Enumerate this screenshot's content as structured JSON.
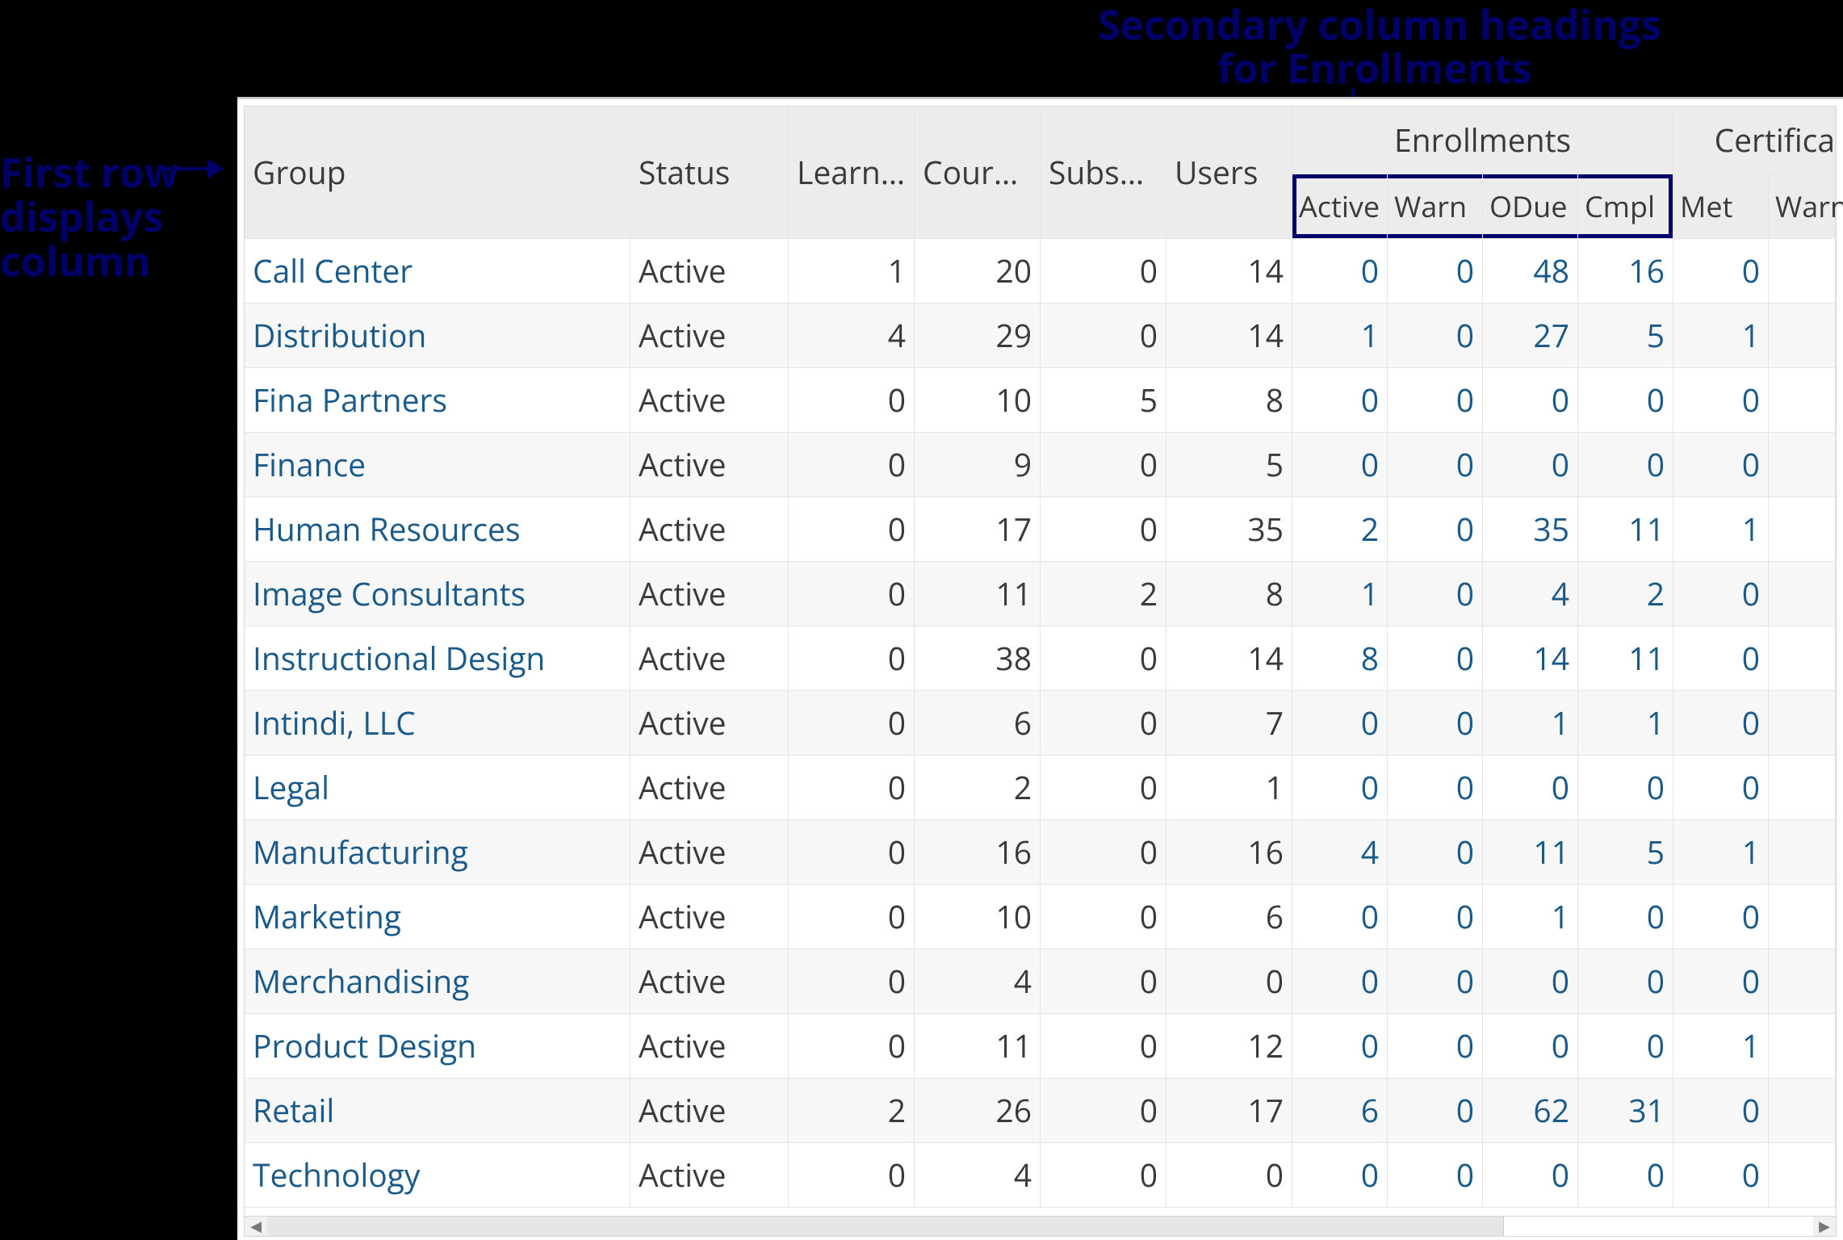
{
  "annotations": {
    "top_line1": "Secondary column headings",
    "top_line2": "for Enrollments",
    "left_line1": "First row",
    "left_line2": "displays",
    "left_line3": "column"
  },
  "headers": {
    "group": "Group",
    "status": "Status",
    "learning": "Learnin…",
    "courses": "Courses",
    "subscriptions": "Subscri…",
    "users": "Users",
    "enrollments_group": "Enrollments",
    "certifications_group": "Certifica",
    "enr_active": "Active",
    "enr_warn": "Warn",
    "enr_odue": "ODue",
    "enr_cmpl": "Cmpl",
    "cert_met": "Met",
    "cert_warn": "Warn"
  },
  "rows": [
    {
      "group": "Call Center",
      "status": "Active",
      "learning": "1",
      "courses": "20",
      "subs": "0",
      "users": "14",
      "e_active": "0",
      "e_warn": "0",
      "e_odue": "48",
      "e_cmpl": "16",
      "c_met": "0",
      "c_warn": ""
    },
    {
      "group": "Distribution",
      "status": "Active",
      "learning": "4",
      "courses": "29",
      "subs": "0",
      "users": "14",
      "e_active": "1",
      "e_warn": "0",
      "e_odue": "27",
      "e_cmpl": "5",
      "c_met": "1",
      "c_warn": ""
    },
    {
      "group": "Fina Partners",
      "status": "Active",
      "learning": "0",
      "courses": "10",
      "subs": "5",
      "users": "8",
      "e_active": "0",
      "e_warn": "0",
      "e_odue": "0",
      "e_cmpl": "0",
      "c_met": "0",
      "c_warn": ""
    },
    {
      "group": "Finance",
      "status": "Active",
      "learning": "0",
      "courses": "9",
      "subs": "0",
      "users": "5",
      "e_active": "0",
      "e_warn": "0",
      "e_odue": "0",
      "e_cmpl": "0",
      "c_met": "0",
      "c_warn": ""
    },
    {
      "group": "Human Resources",
      "status": "Active",
      "learning": "0",
      "courses": "17",
      "subs": "0",
      "users": "35",
      "e_active": "2",
      "e_warn": "0",
      "e_odue": "35",
      "e_cmpl": "11",
      "c_met": "1",
      "c_warn": ""
    },
    {
      "group": "Image Consultants",
      "status": "Active",
      "learning": "0",
      "courses": "11",
      "subs": "2",
      "users": "8",
      "e_active": "1",
      "e_warn": "0",
      "e_odue": "4",
      "e_cmpl": "2",
      "c_met": "0",
      "c_warn": ""
    },
    {
      "group": "Instructional Design",
      "status": "Active",
      "learning": "0",
      "courses": "38",
      "subs": "0",
      "users": "14",
      "e_active": "8",
      "e_warn": "0",
      "e_odue": "14",
      "e_cmpl": "11",
      "c_met": "0",
      "c_warn": ""
    },
    {
      "group": "Intindi, LLC",
      "status": "Active",
      "learning": "0",
      "courses": "6",
      "subs": "0",
      "users": "7",
      "e_active": "0",
      "e_warn": "0",
      "e_odue": "1",
      "e_cmpl": "1",
      "c_met": "0",
      "c_warn": ""
    },
    {
      "group": "Legal",
      "status": "Active",
      "learning": "0",
      "courses": "2",
      "subs": "0",
      "users": "1",
      "e_active": "0",
      "e_warn": "0",
      "e_odue": "0",
      "e_cmpl": "0",
      "c_met": "0",
      "c_warn": ""
    },
    {
      "group": "Manufacturing",
      "status": "Active",
      "learning": "0",
      "courses": "16",
      "subs": "0",
      "users": "16",
      "e_active": "4",
      "e_warn": "0",
      "e_odue": "11",
      "e_cmpl": "5",
      "c_met": "1",
      "c_warn": ""
    },
    {
      "group": "Marketing",
      "status": "Active",
      "learning": "0",
      "courses": "10",
      "subs": "0",
      "users": "6",
      "e_active": "0",
      "e_warn": "0",
      "e_odue": "1",
      "e_cmpl": "0",
      "c_met": "0",
      "c_warn": ""
    },
    {
      "group": "Merchandising",
      "status": "Active",
      "learning": "0",
      "courses": "4",
      "subs": "0",
      "users": "0",
      "e_active": "0",
      "e_warn": "0",
      "e_odue": "0",
      "e_cmpl": "0",
      "c_met": "0",
      "c_warn": ""
    },
    {
      "group": "Product Design",
      "status": "Active",
      "learning": "0",
      "courses": "11",
      "subs": "0",
      "users": "12",
      "e_active": "0",
      "e_warn": "0",
      "e_odue": "0",
      "e_cmpl": "0",
      "c_met": "1",
      "c_warn": ""
    },
    {
      "group": "Retail",
      "status": "Active",
      "learning": "2",
      "courses": "26",
      "subs": "0",
      "users": "17",
      "e_active": "6",
      "e_warn": "0",
      "e_odue": "62",
      "e_cmpl": "31",
      "c_met": "0",
      "c_warn": ""
    },
    {
      "group": "Technology",
      "status": "Active",
      "learning": "0",
      "courses": "4",
      "subs": "0",
      "users": "0",
      "e_active": "0",
      "e_warn": "0",
      "e_odue": "0",
      "e_cmpl": "0",
      "c_met": "0",
      "c_warn": ""
    }
  ]
}
